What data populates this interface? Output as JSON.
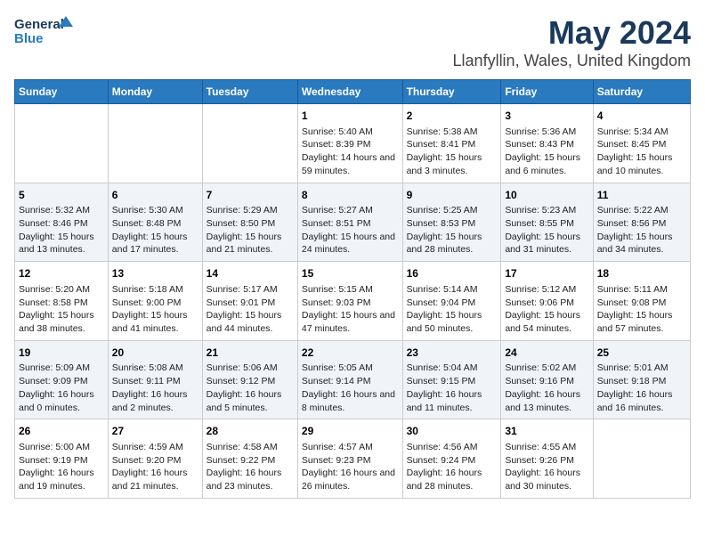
{
  "logo": {
    "line1": "General",
    "line2": "Blue"
  },
  "title": "May 2024",
  "subtitle": "Llanfyllin, Wales, United Kingdom",
  "days_of_week": [
    "Sunday",
    "Monday",
    "Tuesday",
    "Wednesday",
    "Thursday",
    "Friday",
    "Saturday"
  ],
  "weeks": [
    [
      {
        "day": "",
        "text": ""
      },
      {
        "day": "",
        "text": ""
      },
      {
        "day": "",
        "text": ""
      },
      {
        "day": "1",
        "text": "Sunrise: 5:40 AM\nSunset: 8:39 PM\nDaylight: 14 hours and 59 minutes."
      },
      {
        "day": "2",
        "text": "Sunrise: 5:38 AM\nSunset: 8:41 PM\nDaylight: 15 hours and 3 minutes."
      },
      {
        "day": "3",
        "text": "Sunrise: 5:36 AM\nSunset: 8:43 PM\nDaylight: 15 hours and 6 minutes."
      },
      {
        "day": "4",
        "text": "Sunrise: 5:34 AM\nSunset: 8:45 PM\nDaylight: 15 hours and 10 minutes."
      }
    ],
    [
      {
        "day": "5",
        "text": "Sunrise: 5:32 AM\nSunset: 8:46 PM\nDaylight: 15 hours and 13 minutes."
      },
      {
        "day": "6",
        "text": "Sunrise: 5:30 AM\nSunset: 8:48 PM\nDaylight: 15 hours and 17 minutes."
      },
      {
        "day": "7",
        "text": "Sunrise: 5:29 AM\nSunset: 8:50 PM\nDaylight: 15 hours and 21 minutes."
      },
      {
        "day": "8",
        "text": "Sunrise: 5:27 AM\nSunset: 8:51 PM\nDaylight: 15 hours and 24 minutes."
      },
      {
        "day": "9",
        "text": "Sunrise: 5:25 AM\nSunset: 8:53 PM\nDaylight: 15 hours and 28 minutes."
      },
      {
        "day": "10",
        "text": "Sunrise: 5:23 AM\nSunset: 8:55 PM\nDaylight: 15 hours and 31 minutes."
      },
      {
        "day": "11",
        "text": "Sunrise: 5:22 AM\nSunset: 8:56 PM\nDaylight: 15 hours and 34 minutes."
      }
    ],
    [
      {
        "day": "12",
        "text": "Sunrise: 5:20 AM\nSunset: 8:58 PM\nDaylight: 15 hours and 38 minutes."
      },
      {
        "day": "13",
        "text": "Sunrise: 5:18 AM\nSunset: 9:00 PM\nDaylight: 15 hours and 41 minutes."
      },
      {
        "day": "14",
        "text": "Sunrise: 5:17 AM\nSunset: 9:01 PM\nDaylight: 15 hours and 44 minutes."
      },
      {
        "day": "15",
        "text": "Sunrise: 5:15 AM\nSunset: 9:03 PM\nDaylight: 15 hours and 47 minutes."
      },
      {
        "day": "16",
        "text": "Sunrise: 5:14 AM\nSunset: 9:04 PM\nDaylight: 15 hours and 50 minutes."
      },
      {
        "day": "17",
        "text": "Sunrise: 5:12 AM\nSunset: 9:06 PM\nDaylight: 15 hours and 54 minutes."
      },
      {
        "day": "18",
        "text": "Sunrise: 5:11 AM\nSunset: 9:08 PM\nDaylight: 15 hours and 57 minutes."
      }
    ],
    [
      {
        "day": "19",
        "text": "Sunrise: 5:09 AM\nSunset: 9:09 PM\nDaylight: 16 hours and 0 minutes."
      },
      {
        "day": "20",
        "text": "Sunrise: 5:08 AM\nSunset: 9:11 PM\nDaylight: 16 hours and 2 minutes."
      },
      {
        "day": "21",
        "text": "Sunrise: 5:06 AM\nSunset: 9:12 PM\nDaylight: 16 hours and 5 minutes."
      },
      {
        "day": "22",
        "text": "Sunrise: 5:05 AM\nSunset: 9:14 PM\nDaylight: 16 hours and 8 minutes."
      },
      {
        "day": "23",
        "text": "Sunrise: 5:04 AM\nSunset: 9:15 PM\nDaylight: 16 hours and 11 minutes."
      },
      {
        "day": "24",
        "text": "Sunrise: 5:02 AM\nSunset: 9:16 PM\nDaylight: 16 hours and 13 minutes."
      },
      {
        "day": "25",
        "text": "Sunrise: 5:01 AM\nSunset: 9:18 PM\nDaylight: 16 hours and 16 minutes."
      }
    ],
    [
      {
        "day": "26",
        "text": "Sunrise: 5:00 AM\nSunset: 9:19 PM\nDaylight: 16 hours and 19 minutes."
      },
      {
        "day": "27",
        "text": "Sunrise: 4:59 AM\nSunset: 9:20 PM\nDaylight: 16 hours and 21 minutes."
      },
      {
        "day": "28",
        "text": "Sunrise: 4:58 AM\nSunset: 9:22 PM\nDaylight: 16 hours and 23 minutes."
      },
      {
        "day": "29",
        "text": "Sunrise: 4:57 AM\nSunset: 9:23 PM\nDaylight: 16 hours and 26 minutes."
      },
      {
        "day": "30",
        "text": "Sunrise: 4:56 AM\nSunset: 9:24 PM\nDaylight: 16 hours and 28 minutes."
      },
      {
        "day": "31",
        "text": "Sunrise: 4:55 AM\nSunset: 9:26 PM\nDaylight: 16 hours and 30 minutes."
      },
      {
        "day": "",
        "text": ""
      }
    ]
  ]
}
